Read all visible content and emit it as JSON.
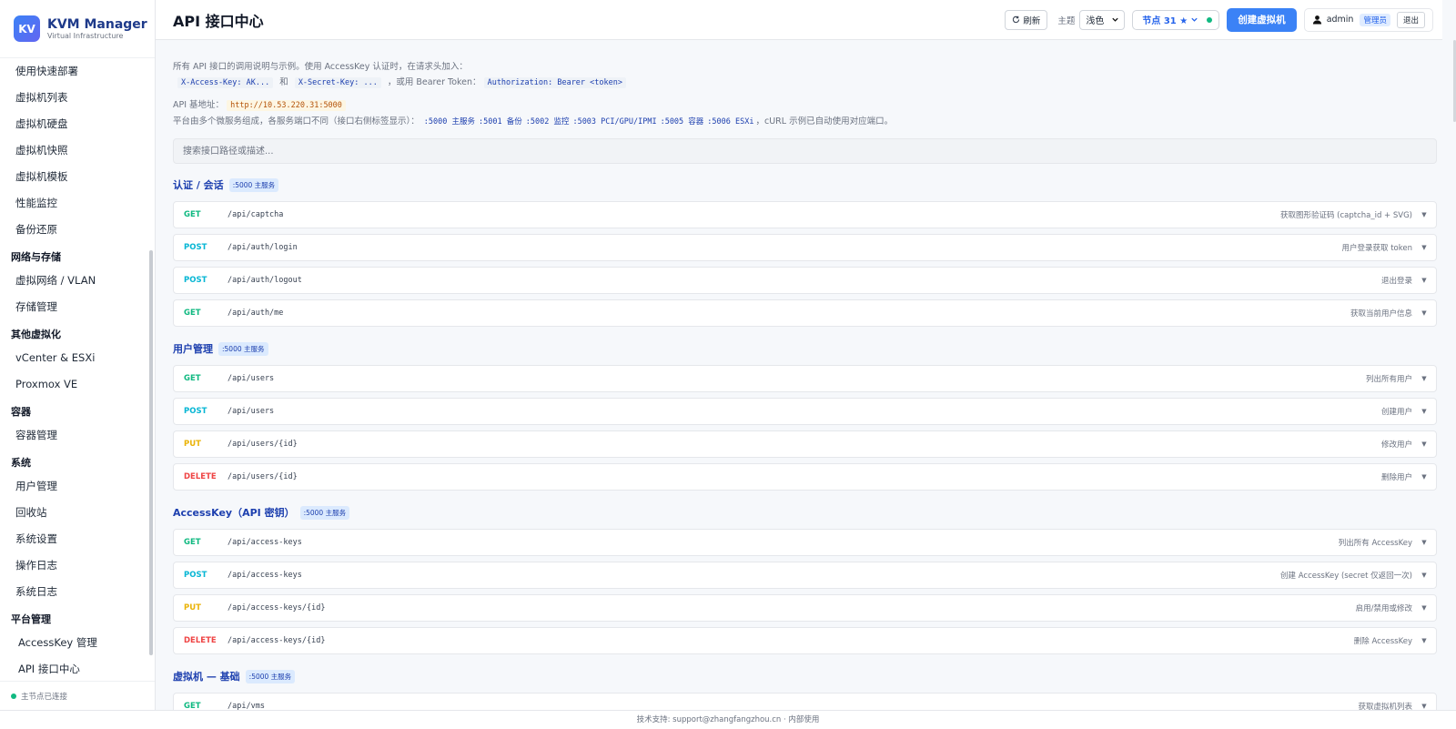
{
  "brand": {
    "logo": "KV",
    "title": "KVM Manager",
    "subtitle": "Virtual Infrastructure"
  },
  "sidebar": [
    {
      "type": "item",
      "label": "使用快速部署"
    },
    {
      "type": "item",
      "label": "虚拟机列表"
    },
    {
      "type": "item",
      "label": "虚拟机硬盘"
    },
    {
      "type": "item",
      "label": "虚拟机快照"
    },
    {
      "type": "item",
      "label": "虚拟机模板"
    },
    {
      "type": "item",
      "label": "性能监控"
    },
    {
      "type": "item",
      "label": "备份还原"
    },
    {
      "type": "group",
      "label": "网络与存储"
    },
    {
      "type": "item",
      "label": "虚拟网络 / VLAN"
    },
    {
      "type": "item",
      "label": "存储管理"
    },
    {
      "type": "group",
      "label": "其他虚拟化"
    },
    {
      "type": "item",
      "label": "vCenter & ESXi"
    },
    {
      "type": "item",
      "label": "Proxmox VE"
    },
    {
      "type": "group",
      "label": "容器"
    },
    {
      "type": "item",
      "label": "容器管理"
    },
    {
      "type": "group",
      "label": "系统"
    },
    {
      "type": "item",
      "label": "用户管理"
    },
    {
      "type": "item",
      "label": "回收站"
    },
    {
      "type": "item",
      "label": "系统设置"
    },
    {
      "type": "item",
      "label": "操作日志"
    },
    {
      "type": "item",
      "label": "系统日志"
    },
    {
      "type": "group",
      "label": "平台管理"
    },
    {
      "type": "item",
      "label": "AccessKey 管理",
      "indent": true
    },
    {
      "type": "item",
      "label": "API 接口中心",
      "indent": true
    }
  ],
  "status_text": "主节点已连接",
  "header": {
    "title": "API 接口中心",
    "refresh_label": "刷新",
    "theme_label": "主题",
    "theme_value": "浅色",
    "node_label": "节点 31 ★",
    "create_vm_label": "创建虚拟机",
    "user_name": "admin",
    "role_badge": "管理员",
    "logout_label": "退出"
  },
  "intro": {
    "line1_text": "所有 API 接口的调用说明与示例。使用 AccessKey 认证时，在请求头加入：",
    "header_key": "X-Access-Key: AK...",
    "and_text": "和",
    "header_secret": "X-Secret-Key: ...",
    "or_text": "，或用 Bearer Token：",
    "bearer": "Authorization: Bearer <token>",
    "base_label": "API 基地址：",
    "base_url": "http://10.53.220.31:5000",
    "micro_text": "平台由多个微服务组成，各服务端口不同（接口右侧标签显示）：",
    "ports": [
      ":5000 主服务",
      ":5001 备份",
      ":5002 监控",
      ":5003 PCI/GPU/IPMI",
      ":5005 容器",
      ":5006 ESXi"
    ],
    "micro_tail": "，cURL 示例已自动使用对应端口。"
  },
  "search": {
    "placeholder": "搜索接口路径或描述..."
  },
  "sections": [
    {
      "title": "认证 / 会话",
      "badge": ":5000 主服务",
      "endpoints": [
        {
          "method": "GET",
          "path": "/api/captcha",
          "desc": "获取图形验证码 (captcha_id + SVG)"
        },
        {
          "method": "POST",
          "path": "/api/auth/login",
          "desc": "用户登录获取 token"
        },
        {
          "method": "POST",
          "path": "/api/auth/logout",
          "desc": "退出登录"
        },
        {
          "method": "GET",
          "path": "/api/auth/me",
          "desc": "获取当前用户信息"
        }
      ]
    },
    {
      "title": "用户管理",
      "badge": ":5000 主服务",
      "endpoints": [
        {
          "method": "GET",
          "path": "/api/users",
          "desc": "列出所有用户"
        },
        {
          "method": "POST",
          "path": "/api/users",
          "desc": "创建用户"
        },
        {
          "method": "PUT",
          "path": "/api/users/{id}",
          "desc": "修改用户"
        },
        {
          "method": "DELETE",
          "path": "/api/users/{id}",
          "desc": "删除用户"
        }
      ]
    },
    {
      "title": "AccessKey（API 密钥）",
      "badge": ":5000 主服务",
      "endpoints": [
        {
          "method": "GET",
          "path": "/api/access-keys",
          "desc": "列出所有 AccessKey"
        },
        {
          "method": "POST",
          "path": "/api/access-keys",
          "desc": "创建 AccessKey (secret 仅返回一次)"
        },
        {
          "method": "PUT",
          "path": "/api/access-keys/{id}",
          "desc": "启用/禁用或修改"
        },
        {
          "method": "DELETE",
          "path": "/api/access-keys/{id}",
          "desc": "删除 AccessKey"
        }
      ]
    },
    {
      "title": "虚拟机 — 基础",
      "badge": ":5000 主服务",
      "endpoints": [
        {
          "method": "GET",
          "path": "/api/vms",
          "desc": "获取虚拟机列表"
        }
      ]
    }
  ],
  "footer": {
    "text": "技术支持: support@zhangfangzhou.cn · 内部使用"
  }
}
